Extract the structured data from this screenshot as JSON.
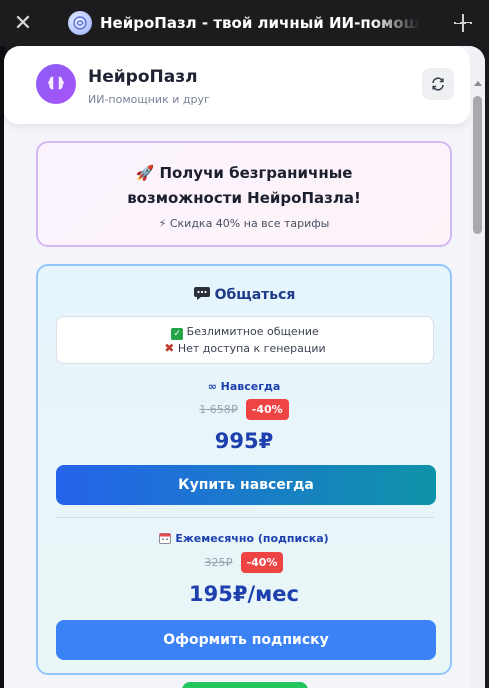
{
  "titlebar": {
    "close_label": "✕",
    "title": "НейроПазл - твой личный ИИ-помощник"
  },
  "header": {
    "name": "НейроПазл",
    "subtitle": "ИИ-помощник и друг"
  },
  "promo": {
    "title": "🚀 Получи безграничные возможности НейроПазла!",
    "subtitle": "⚡ Скидка 40% на все тарифы"
  },
  "plan": {
    "name": "Общаться",
    "features": [
      "Безлимитное общение",
      "Нет доступа к генерации"
    ],
    "forever": {
      "period": "∞ Навсегда",
      "old_price": "1 658₽",
      "discount": "-40%",
      "price": "995₽",
      "button": "Купить навсегда"
    },
    "monthly": {
      "period": "Ежемесячно (подписка)",
      "old_price": "325₽",
      "discount": "-40%",
      "price": "195₽/мес",
      "button": "Оформить подписку"
    }
  },
  "colors": {
    "accent": "#3b82f6",
    "brand": "#8b5cf6",
    "discount": "#ef4444"
  }
}
